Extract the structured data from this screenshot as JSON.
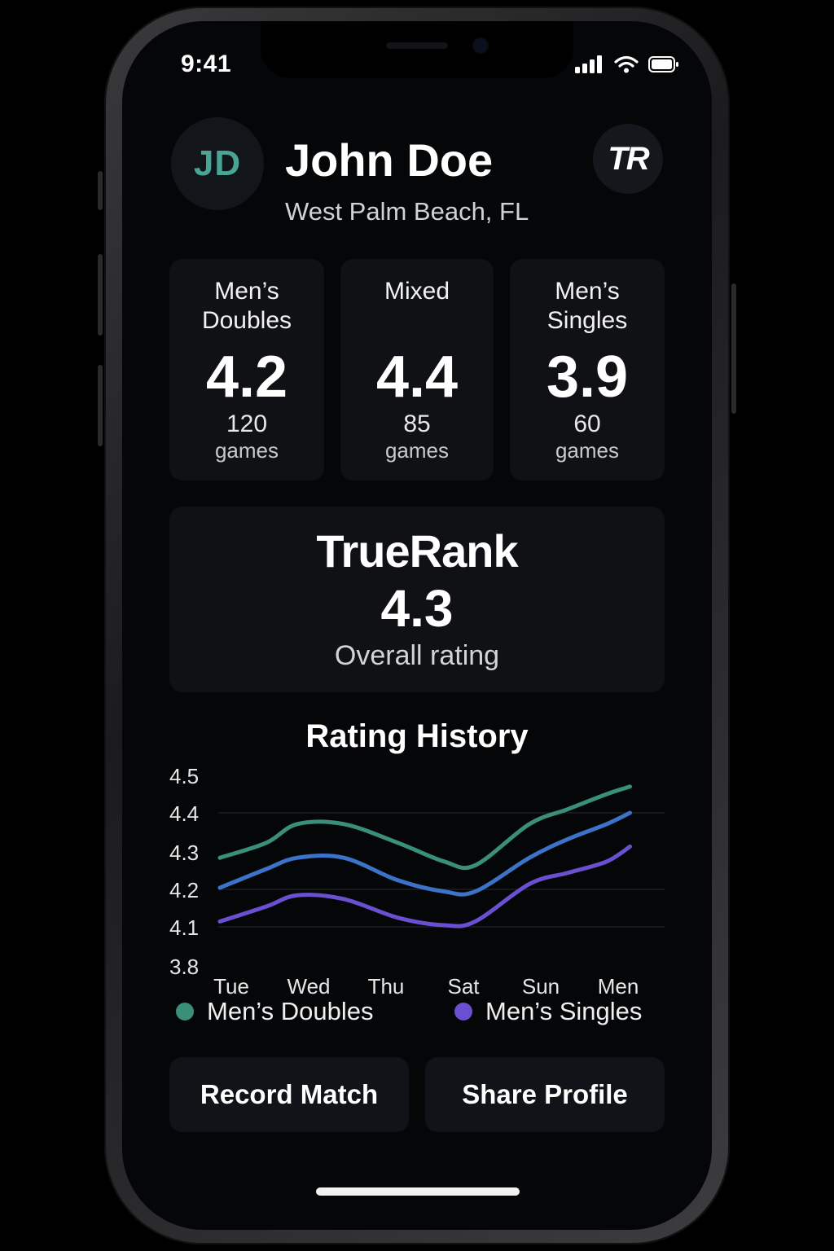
{
  "status_bar": {
    "time": "9:41"
  },
  "profile": {
    "initials": "JD",
    "name": "John Doe",
    "location": "West Palm Beach, FL",
    "badge": "TR"
  },
  "ratings": [
    {
      "title": "Men’s\nDoubles",
      "value": "4.2",
      "games": "120",
      "unit": "games"
    },
    {
      "title": "Mixed",
      "value": "4.4",
      "games": "85",
      "unit": "games"
    },
    {
      "title": "Men’s\nSingles",
      "value": "3.9",
      "games": "60",
      "unit": "games"
    }
  ],
  "truerank": {
    "title": "TrueRank",
    "value": "4.3",
    "subtitle": "Overall rating"
  },
  "chart_data": {
    "type": "line",
    "title": "Rating History",
    "y_ticks": [
      "4.5",
      "4.4",
      "4.3",
      "4.2",
      "4.1",
      "3.8"
    ],
    "categories": [
      "Tue",
      "Wed",
      "Thu",
      "Sat",
      "Sun",
      "Men"
    ],
    "gridlines": true,
    "series": [
      {
        "name": "Men’s Doubles",
        "color": "#3a8f7a",
        "x": [
          0,
          0.6,
          1.0,
          1.6,
          2.3,
          2.9,
          3.3,
          4.0,
          4.5,
          5.0,
          5.3
        ],
        "values": [
          4.28,
          4.32,
          4.37,
          4.37,
          4.32,
          4.27,
          4.26,
          4.37,
          4.41,
          4.45,
          4.47
        ]
      },
      {
        "name": "",
        "color": "#3c72c8",
        "x": [
          0,
          0.6,
          1.0,
          1.6,
          2.3,
          2.9,
          3.3,
          4.0,
          4.5,
          5.0,
          5.3
        ],
        "values": [
          4.2,
          4.25,
          4.28,
          4.28,
          4.22,
          4.19,
          4.19,
          4.28,
          4.33,
          4.37,
          4.4
        ]
      },
      {
        "name": "Men’s Singles",
        "color": "#6a4fd0",
        "x": [
          0,
          0.6,
          1.0,
          1.6,
          2.3,
          2.9,
          3.3,
          4.0,
          4.5,
          5.0,
          5.3
        ],
        "values": [
          4.11,
          4.15,
          4.18,
          4.17,
          4.12,
          4.1,
          4.11,
          4.21,
          4.24,
          4.27,
          4.31
        ]
      }
    ]
  },
  "legend": [
    {
      "label": "Men’s Doubles",
      "color": "#3a8f7a"
    },
    {
      "label": "Men’s Singles",
      "color": "#6a4fd0"
    }
  ],
  "actions": {
    "record_match": "Record Match",
    "share_profile": "Share Profile"
  }
}
